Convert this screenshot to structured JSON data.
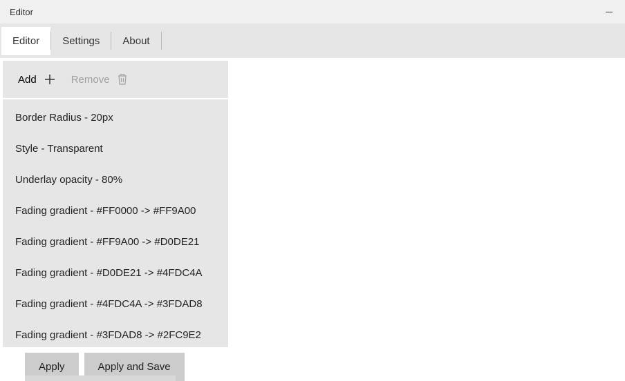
{
  "window": {
    "title": "Editor"
  },
  "tabs": [
    {
      "label": "Editor",
      "active": true
    },
    {
      "label": "Settings",
      "active": false
    },
    {
      "label": "About",
      "active": false
    }
  ],
  "toolbar": {
    "add_label": "Add",
    "remove_label": "Remove"
  },
  "list_items": [
    "Border Radius - 20px",
    "Style - Transparent",
    "Underlay opacity - 80%",
    "Fading gradient - #FF0000 -> #FF9A00",
    "Fading gradient - #FF9A00 -> #D0DE21",
    "Fading gradient - #D0DE21 -> #4FDC4A",
    "Fading gradient - #4FDC4A -> #3FDAD8",
    "Fading gradient - #3FDAD8 -> #2FC9E2"
  ],
  "actions": {
    "apply_label": "Apply",
    "apply_save_label": "Apply and Save"
  }
}
